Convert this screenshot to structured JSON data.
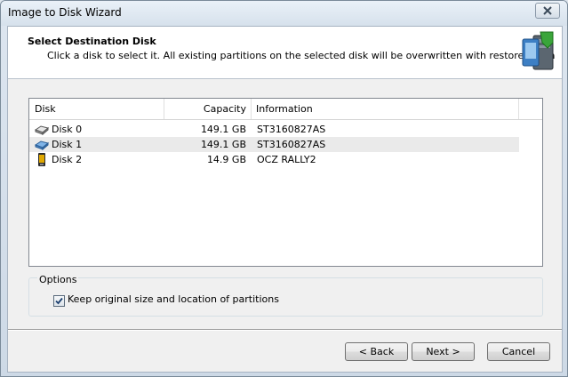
{
  "window": {
    "title": "Image to Disk Wizard"
  },
  "header": {
    "title": "Select Destination Disk",
    "subtitle": "Click a disk to select it. All existing partitions on the selected disk will be overwritten with restored data"
  },
  "disk_list": {
    "columns": [
      "Disk",
      "Capacity",
      "Information"
    ],
    "rows": [
      {
        "disk": "Disk 0",
        "capacity": "149.1 GB",
        "information": "ST3160827AS",
        "icon": "hard-disk-icon"
      },
      {
        "disk": "Disk 1",
        "capacity": "149.1 GB",
        "information": "ST3160827AS",
        "icon": "hard-disk-blue-icon"
      },
      {
        "disk": "Disk 2",
        "capacity": "14.9 GB",
        "information": "OCZ RALLY2",
        "icon": "usb-drive-icon"
      }
    ]
  },
  "options": {
    "label": "Options",
    "keep_partitions_label": "Keep original size and location of partitions",
    "keep_partitions_checked": true
  },
  "buttons": {
    "back": "< Back",
    "next": "Next >",
    "cancel": "Cancel"
  }
}
